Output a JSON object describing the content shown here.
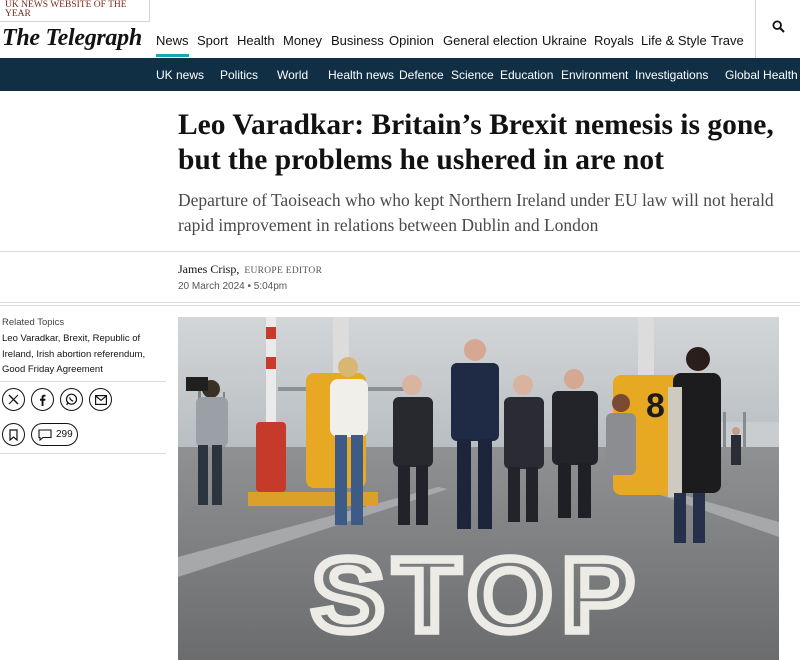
{
  "award": "UK NEWS WEBSITE OF THE YEAR",
  "logo": "The Telegraph",
  "primary_nav": [
    "News",
    "Sport",
    "Health",
    "Money",
    "Business",
    "Opinion",
    "General election",
    "Ukraine",
    "Royals",
    "Life & Style",
    "Travel"
  ],
  "active_nav": "News",
  "secondary_nav": [
    "UK news",
    "Politics",
    "World",
    "Health news",
    "Defence",
    "Science",
    "Education",
    "Environment",
    "Investigations",
    "Global Health Se"
  ],
  "article": {
    "headline": "Leo Varadkar: Britain’s Brexit nemesis is gone, but the problems he ushered in are not",
    "standfirst": "Departure of Taoiseach who who kept Northern Ireland under EU law will not herald rapid improvement in relations between Dublin and London",
    "author": "James Crisp,",
    "author_role": "Europe Editor",
    "date": "20 March 2024 • 5:04pm"
  },
  "sidebar": {
    "related_title": "Related Topics",
    "related_links": "Leo Varadkar, Brexit, Republic of Ireland, Irish abortion referendum, Good Friday Agreement",
    "share_icons": [
      "x-icon",
      "facebook-icon",
      "whatsapp-icon",
      "email-icon"
    ],
    "comment_count": "299"
  },
  "photo": {
    "road_text": "STOP",
    "sign_number": "8"
  },
  "colors": {
    "nav_bar": "#102f45",
    "active_underline": "#15a7b4",
    "award_text": "#7a2a1c"
  }
}
